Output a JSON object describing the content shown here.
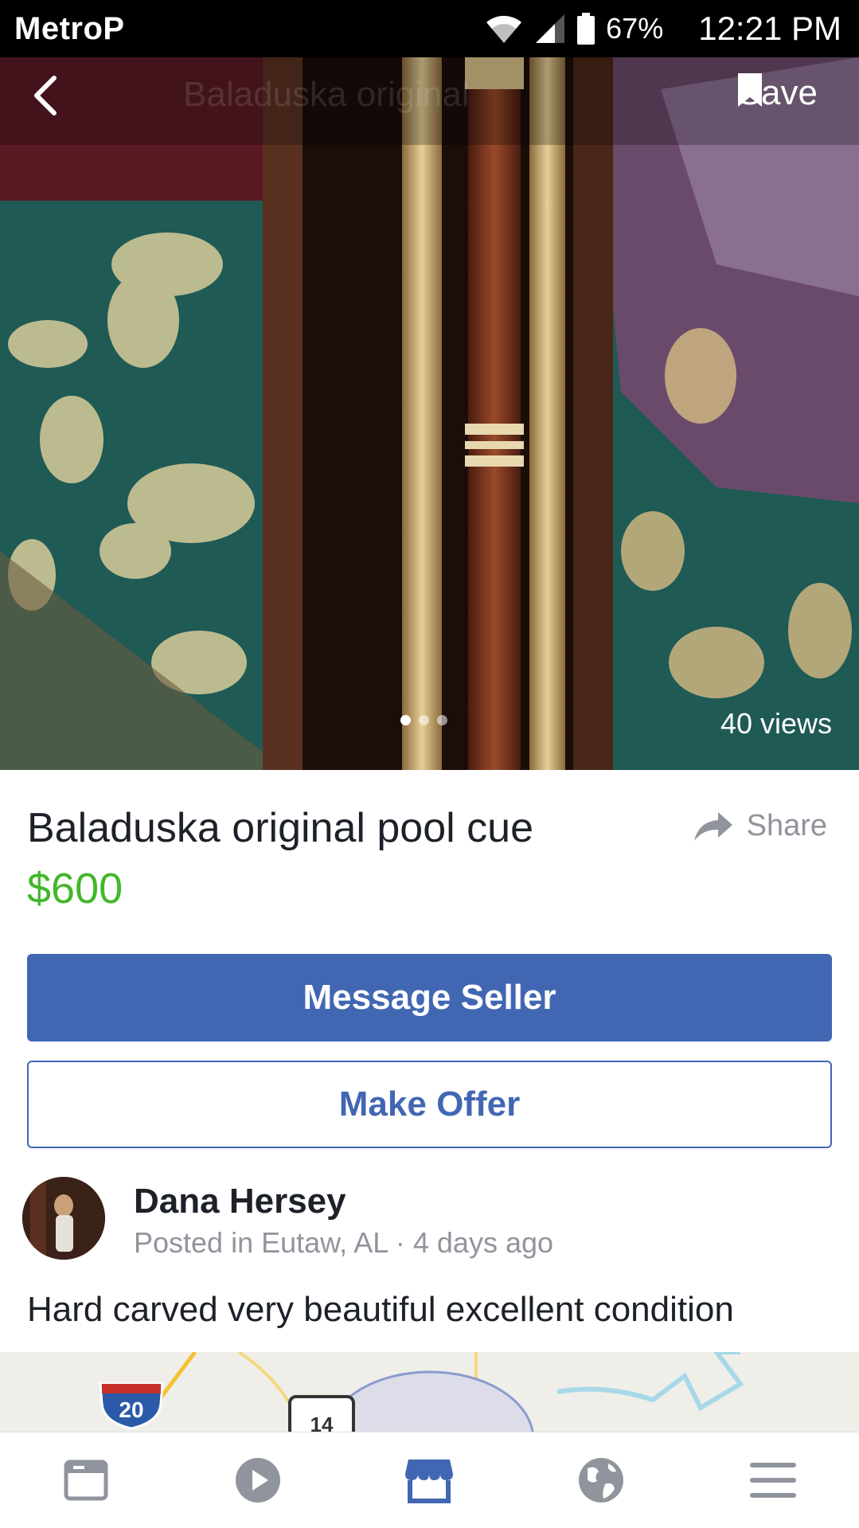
{
  "status_bar": {
    "carrier": "MetroP",
    "battery_percent": "67%",
    "time": "12:21 PM"
  },
  "photo": {
    "ghost_title": "Baladuska original",
    "save_label": "Save",
    "views": "40 views",
    "current_image": 1,
    "total_images": 3
  },
  "listing": {
    "title": "Baladuska original pool cue",
    "price": "$600",
    "share_label": "Share"
  },
  "actions": {
    "message_seller": "Message Seller",
    "make_offer": "Make Offer"
  },
  "seller": {
    "name": "Dana Hersey",
    "meta": "Posted in Eutaw, AL · 4 days ago"
  },
  "description": "Hard carved very beautiful excellent condition",
  "map": {
    "interstate_shield": "20",
    "highway_shield": "14"
  },
  "tabs": [
    {
      "icon": "news-feed-icon",
      "active": false
    },
    {
      "icon": "video-icon",
      "active": false
    },
    {
      "icon": "marketplace-icon",
      "active": true
    },
    {
      "icon": "notifications-globe-icon",
      "active": false
    },
    {
      "icon": "menu-icon",
      "active": false
    }
  ],
  "colors": {
    "brand": "#4267b2",
    "price": "#42b72a",
    "secondary_text": "#90949c"
  }
}
